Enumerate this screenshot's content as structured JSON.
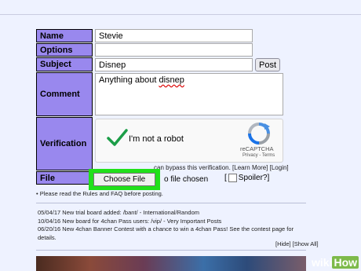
{
  "form": {
    "name": {
      "label": "Name",
      "value": "Stevie"
    },
    "options": {
      "label": "Options",
      "value": ""
    },
    "subject": {
      "label": "Subject",
      "value": "Disnep",
      "post_button": "Post"
    },
    "comment": {
      "label": "Comment",
      "text_before": "Anything about ",
      "misspelled": "disnep"
    },
    "verification": {
      "label": "Verification",
      "robot_text": "I'm not a robot",
      "brand": "reCAPTCHA",
      "links": "Privacy - Terms",
      "pass_note": "can bypass this verification. [Learn More] [Login]"
    },
    "file": {
      "label": "File",
      "choose_button": "Choose File",
      "status": "o file chosen",
      "spoiler": "Spoiler?]",
      "spoiler_prefix": "["
    }
  },
  "rules_note": "• Please read the Rules and FAQ before posting.",
  "news": [
    {
      "date": "05/04/17",
      "text": "New trial board added: /bant/ - International/Random"
    },
    {
      "date": "10/04/16",
      "text": "New board for 4chan Pass users: /vip/ - Very Important Posts"
    },
    {
      "date": "06/20/16",
      "text": "New 4chan Banner Contest with a chance to win a 4chan Pass! See the contest page for details."
    }
  ],
  "news_controls": "[Hide] [Show All]",
  "watermark": {
    "part1": "wiki",
    "part2": "How"
  },
  "colors": {
    "label_bg": "#9988ee",
    "page_bg": "#eef2ff",
    "highlight": "#21e01a",
    "check": "#1c9e48"
  }
}
